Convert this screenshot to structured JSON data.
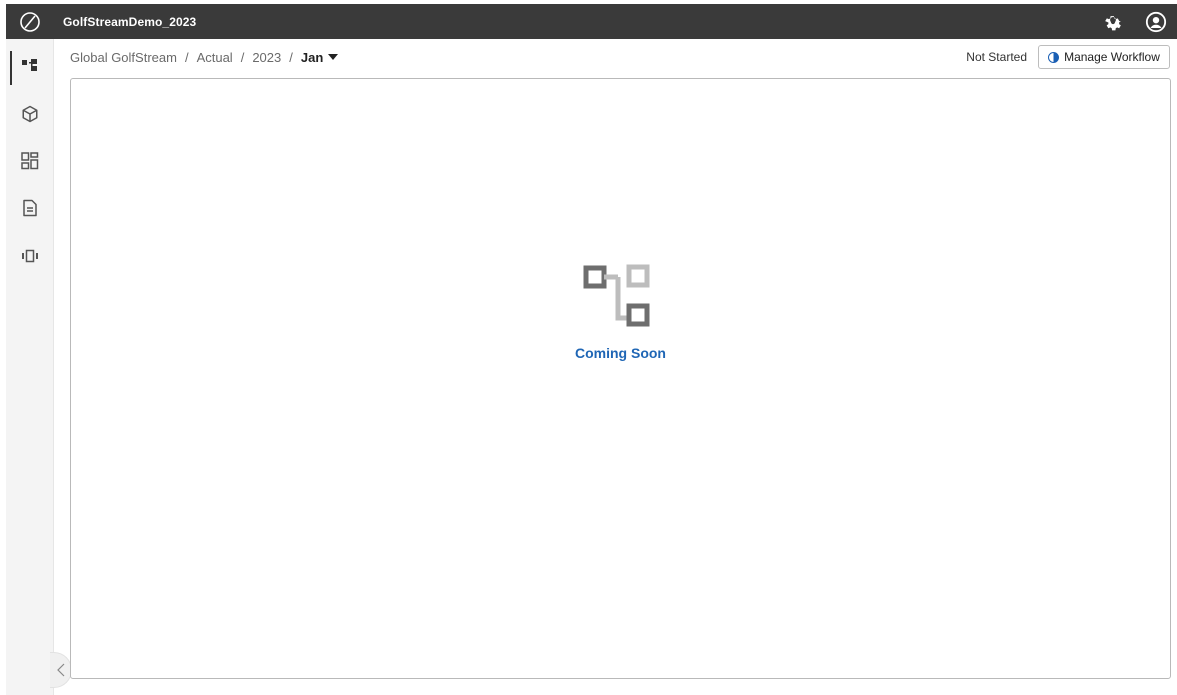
{
  "app": {
    "title": "GolfStreamDemo_2023",
    "logo_icon": "oracle-epm-logo"
  },
  "header": {
    "settings_icon": "gear-icon",
    "user_icon": "user-avatar-icon"
  },
  "sidebar": {
    "items": [
      {
        "icon": "hierarchy-icon",
        "active": true
      },
      {
        "icon": "cube-icon",
        "active": false
      },
      {
        "icon": "dashboard-icon",
        "active": false
      },
      {
        "icon": "document-icon",
        "active": false
      },
      {
        "icon": "carousel-icon",
        "active": false
      }
    ]
  },
  "breadcrumb": {
    "items": [
      "Global GolfStream",
      "Actual",
      "2023"
    ],
    "separator": "/",
    "current": "Jan"
  },
  "workflow": {
    "status": "Not Started",
    "button_label": "Manage Workflow"
  },
  "main": {
    "empty_icon": "hierarchy-icon",
    "message": "Coming Soon"
  },
  "colors": {
    "topbar": "#3a3a3a",
    "accent": "#1f66b5"
  }
}
